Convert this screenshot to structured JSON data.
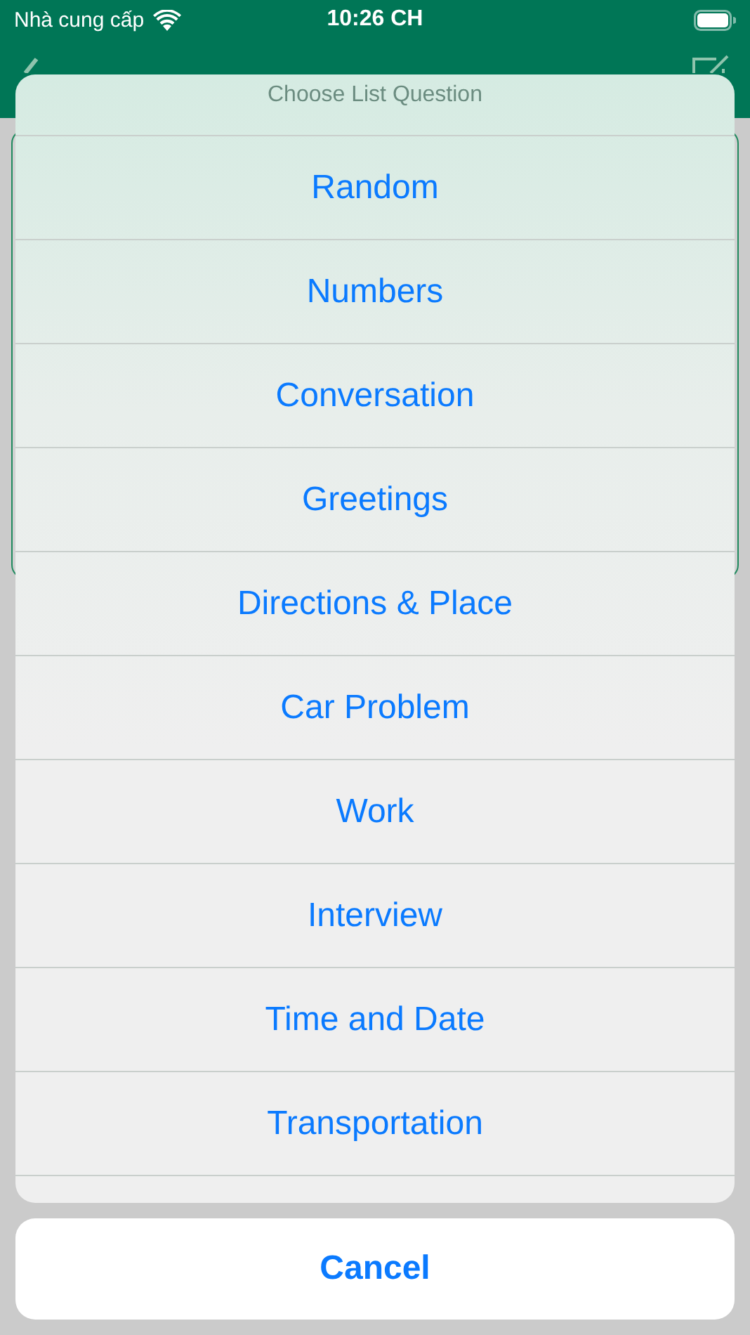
{
  "status_bar": {
    "carrier": "Nhà cung cấp",
    "time": "10:26 CH"
  },
  "action_sheet": {
    "title": "Choose List Question",
    "options": [
      "Random",
      "Numbers",
      "Conversation",
      "Greetings",
      "Directions & Place",
      "Car Problem",
      "Work",
      "Interview",
      "Time and Date",
      "Transportation"
    ],
    "cancel": "Cancel"
  }
}
